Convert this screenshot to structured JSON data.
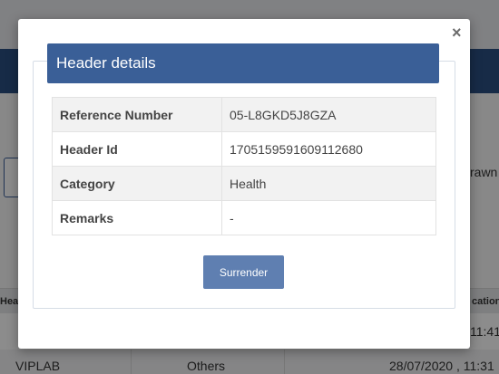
{
  "background": {
    "drawn_fragment": "rawn",
    "table_header_left": "Hea",
    "table_header_right": "cation",
    "row1_right": "11:41",
    "row2": {
      "col1": "VIPLAB",
      "col2": "Others",
      "col3": "28/07/2020 , 11:31"
    }
  },
  "modal": {
    "close_glyph": "×",
    "title": "Header details",
    "rows": [
      {
        "label": "Reference Number",
        "value": "05-L8GKD5J8GZA"
      },
      {
        "label": "Header Id",
        "value": "1705159591609112680"
      },
      {
        "label": "Category",
        "value": "Health"
      },
      {
        "label": "Remarks",
        "value": "-"
      }
    ],
    "surrender_label": "Surrender"
  },
  "colors": {
    "header_blue": "#3a5f97",
    "button_blue": "#5f7fb1",
    "nav_blue": "#2b4f81"
  }
}
